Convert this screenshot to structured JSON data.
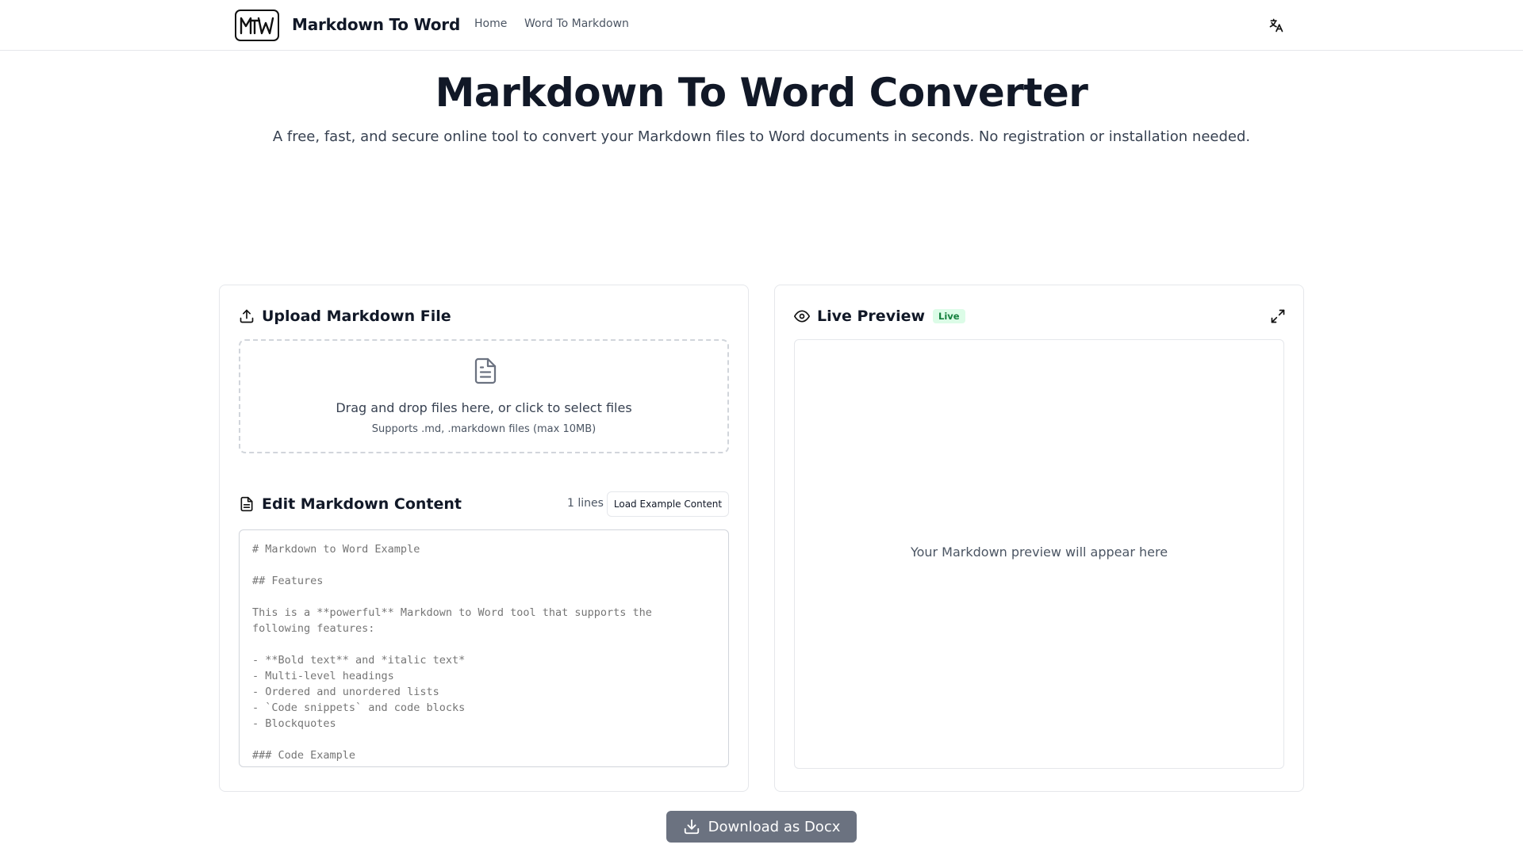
{
  "header": {
    "logo_text": "MTW",
    "brand": "Markdown To Word",
    "nav": [
      {
        "label": "Home"
      },
      {
        "label": "Word To Markdown"
      }
    ],
    "lang_icon": "translate-icon"
  },
  "hero": {
    "title": "Markdown To Word Converter",
    "subtitle": "A free, fast, and secure online tool to convert your Markdown files to Word documents in seconds. No registration or installation needed."
  },
  "upload": {
    "title": "Upload Markdown File",
    "icon": "upload-icon",
    "drop_text": "Drag and drop files here, or click to select files",
    "drop_hint": "Supports .md, .markdown files (max 10MB)",
    "file_icon": "document-icon"
  },
  "editor": {
    "title": "Edit Markdown Content",
    "icon": "document-icon",
    "lines_label": "1 lines",
    "load_button": "Load Example Content",
    "placeholder": "# Markdown to Word Example\n\n## Features\n\nThis is a **powerful** Markdown to Word tool that supports the following features:\n\n- **Bold text** and *italic text*\n- Multi-level headings\n- Ordered and unordered lists\n- `Code snippets` and code blocks\n- Blockquotes\n\n### Code Example"
  },
  "preview": {
    "title": "Live Preview",
    "badge": "Live",
    "icon": "eye-icon",
    "expand_icon": "expand-icon",
    "empty_text": "Your Markdown preview will appear here"
  },
  "actions": {
    "download_label": "Download as Docx",
    "download_icon": "download-icon"
  },
  "colors": {
    "accent_badge_bg": "#dcfce7",
    "accent_badge_text": "#15803d",
    "download_button_bg": "#6b7280"
  }
}
